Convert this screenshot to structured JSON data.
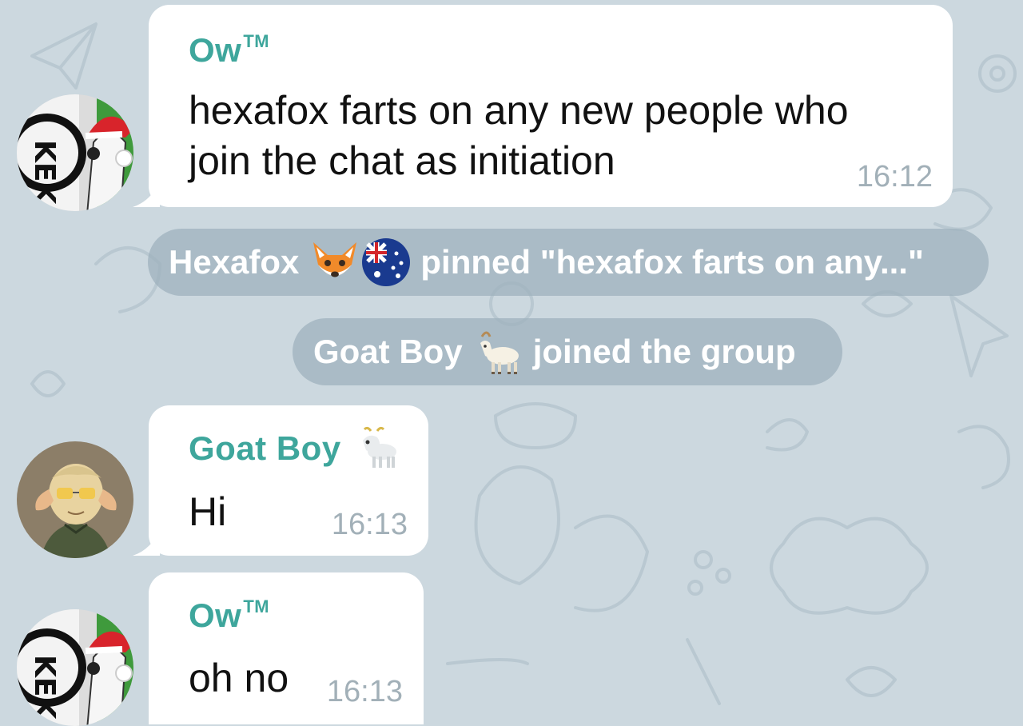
{
  "messages": [
    {
      "sender": "Ow",
      "sender_mark": "TM",
      "text_lines": [
        "hexafox farts on any new people who",
        "join the chat as initiation"
      ],
      "time": "16:12"
    },
    {
      "sender": "Goat Boy",
      "sender_emoji": "goat-icon",
      "text_lines": [
        "Hi"
      ],
      "time": "16:13"
    },
    {
      "sender": "Ow",
      "sender_mark": "TM",
      "text_lines": [
        "oh no"
      ],
      "time": "16:13"
    }
  ],
  "service_messages": [
    {
      "actor": "Hexafox",
      "actor_emojis": [
        "fox-face-icon",
        "australia-flag-icon"
      ],
      "action": "pinned \"hexafox farts on any...\""
    },
    {
      "actor": "Goat Boy",
      "actor_emojis": [
        "goat-icon"
      ],
      "action": "joined the group"
    }
  ],
  "colors": {
    "background": "#ccd8df",
    "bubble": "#ffffff",
    "sender_name": "#3ea69c",
    "timestamp": "#a2b0b8",
    "service_pill": "#9cb0bc"
  }
}
